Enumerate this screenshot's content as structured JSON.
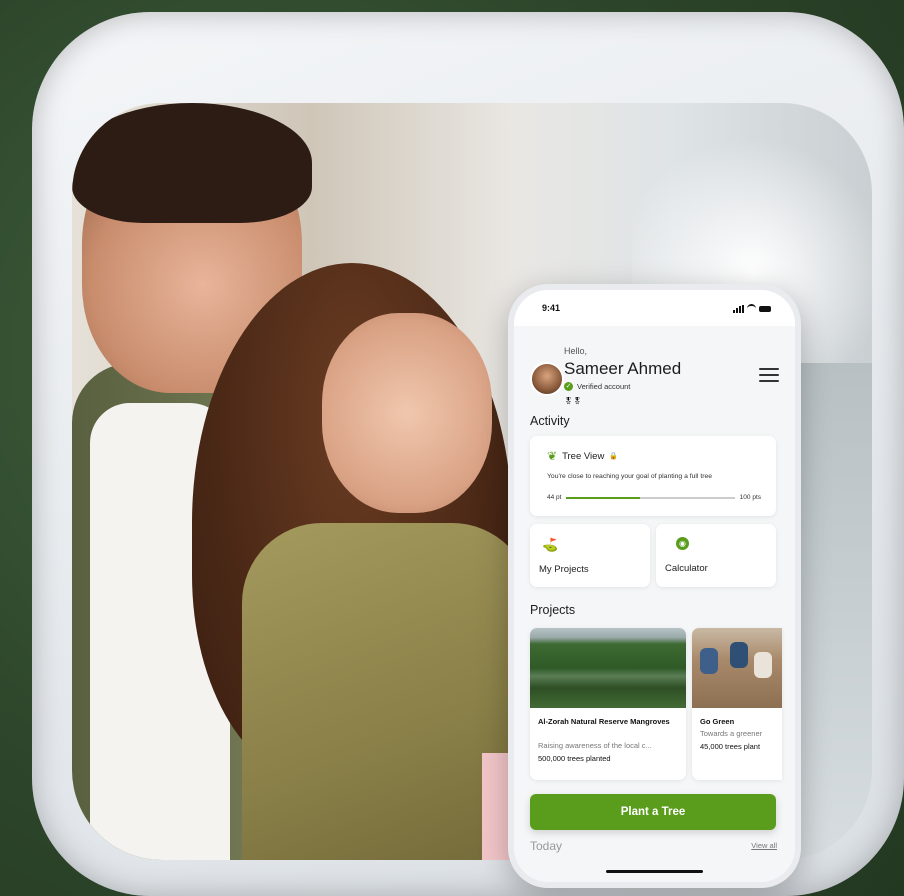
{
  "status_bar": {
    "time": "9:41"
  },
  "greeting": {
    "hello": "Hello,",
    "name": "Sameer Ahmed",
    "verified": "Verified account"
  },
  "activity": {
    "heading": "Activity",
    "tree_view": {
      "title": "Tree View",
      "description": "You're close to reaching your goal of planting a full tree",
      "progress_start_label": "44 pt",
      "progress_end_label": "100 pts",
      "progress_fraction": 0.44
    },
    "shortcuts": [
      {
        "label": "My Projects",
        "icon": "map-pin-icon"
      },
      {
        "label": "Calculator",
        "icon": "calculator-icon"
      }
    ]
  },
  "projects": {
    "heading": "Projects",
    "items": [
      {
        "title": "Al-Zorah Natural Reserve Mangroves",
        "subtitle": "Raising awareness of the local c...",
        "count": "500,000  trees planted"
      },
      {
        "title": "Go Green",
        "subtitle": "Towards a greener",
        "count": "45,000 trees plant"
      }
    ]
  },
  "cta": {
    "label": "Plant a Tree"
  },
  "today": {
    "heading": "Today",
    "view_all": "View all"
  },
  "colors": {
    "accent": "#5a9c1c",
    "background": "#2f4a2e"
  }
}
